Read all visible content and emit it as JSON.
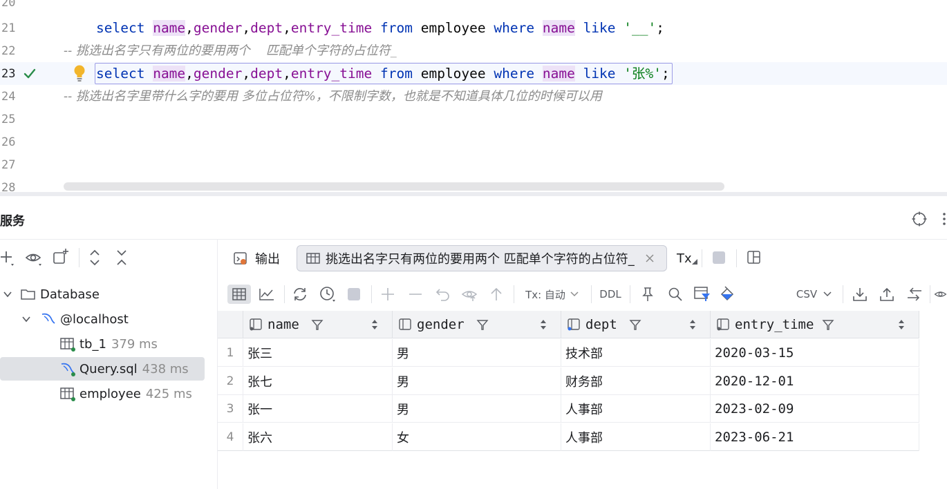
{
  "editor": {
    "line_numbers": [
      "20",
      "21",
      "22",
      "23",
      "24",
      "25",
      "26",
      "27",
      "28"
    ],
    "line21": {
      "select": "select",
      "name": "name",
      "c1": ",",
      "gender": "gender",
      "c2": ",",
      "dept": "dept",
      "c3": ",",
      "entry_time": "entry_time",
      "from": "from",
      "table": "employee",
      "where": "where",
      "name2": "name",
      "like": "like",
      "pattern": "'__'",
      "semi": ";"
    },
    "line22_comment": "-- 挑选出名字只有两位的要用两个    匹配单个字符的占位符_",
    "line23": {
      "select": "select",
      "name": "name",
      "c1": ",",
      "gender": "gender",
      "c2": ",",
      "dept": "dept",
      "c3": ",",
      "entry_time": "entry_time",
      "from": "from",
      "table": "employee",
      "where": "where",
      "name2": "name",
      "like": "like",
      "pattern": "'张%'",
      "semi": ";"
    },
    "line24_comment": "-- 挑选出名字里带什么字的要用 多位占位符%，不限制字数，也就是不知道具体几位的时候可以用"
  },
  "services": {
    "title": "服务",
    "tree": {
      "root": "Database",
      "host": "@localhost",
      "items": [
        {
          "label": "tb_1",
          "time": "379 ms"
        },
        {
          "label": "Query.sql",
          "time": "438 ms"
        },
        {
          "label": "employee",
          "time": "425 ms"
        }
      ]
    },
    "tabs": {
      "output": "输出",
      "result": "挑选出名字只有两位的要用两个   匹配单个字符的占位符_",
      "tx": "Tx"
    },
    "grid_toolbar": {
      "tx_mode": "Tx: 自动",
      "ddl": "DDL",
      "export_format": "CSV"
    },
    "table": {
      "columns": [
        "name",
        "gender",
        "dept",
        "entry_time"
      ],
      "rows": [
        {
          "n": "1",
          "name": "张三",
          "gender": "男",
          "dept": "技术部",
          "entry_time": "2020-03-15"
        },
        {
          "n": "2",
          "name": "张七",
          "gender": "男",
          "dept": "财务部",
          "entry_time": "2020-12-01"
        },
        {
          "n": "3",
          "name": "张一",
          "gender": "男",
          "dept": "人事部",
          "entry_time": "2023-02-09"
        },
        {
          "n": "4",
          "name": "张六",
          "gender": "女",
          "dept": "人事部",
          "entry_time": "2023-06-21"
        }
      ]
    }
  },
  "colors": {
    "keyword": "#0033b3",
    "field": "#871094",
    "string": "#067d17",
    "comment": "#8c8c8c",
    "check": "#2a8c4a",
    "bulb": "#f2b52b"
  }
}
